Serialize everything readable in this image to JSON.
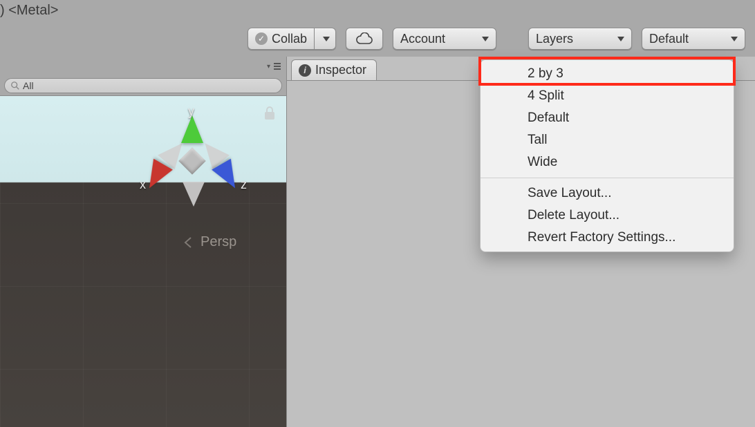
{
  "titlebar": {
    "text": ") <Metal>"
  },
  "toolbar": {
    "collab_label": "Collab",
    "account_label": "Account",
    "layers_label": "Layers",
    "layout_label": "Default"
  },
  "search": {
    "placeholder": "All"
  },
  "scene": {
    "axis_x": "x",
    "axis_y": "y",
    "axis_z": "z",
    "projection_label": "Persp"
  },
  "inspector": {
    "tab_label": "Inspector"
  },
  "layout_menu": {
    "items": [
      {
        "label": "2 by 3"
      },
      {
        "label": "4 Split"
      },
      {
        "label": "Default"
      },
      {
        "label": "Tall"
      },
      {
        "label": "Wide"
      }
    ],
    "actions": [
      {
        "label": "Save Layout..."
      },
      {
        "label": "Delete Layout..."
      },
      {
        "label": "Revert Factory Settings..."
      }
    ],
    "highlighted_index": 0
  }
}
